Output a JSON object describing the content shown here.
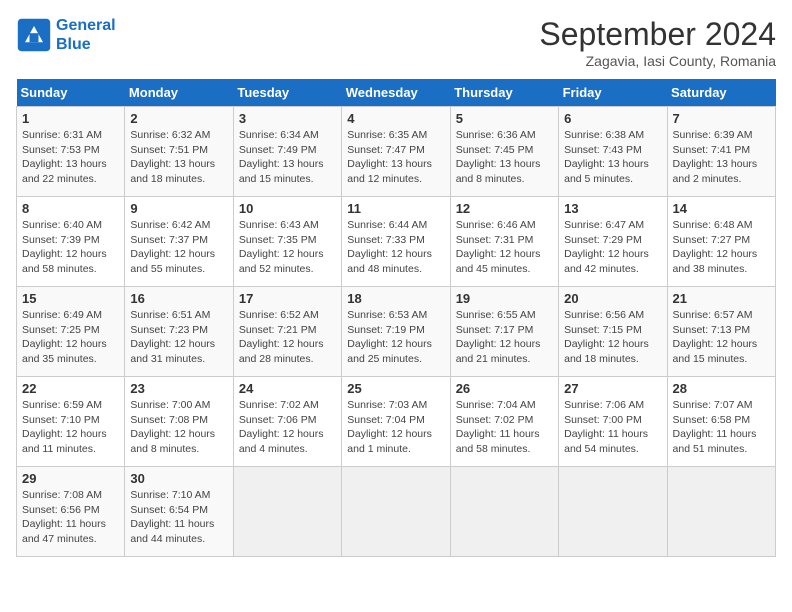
{
  "header": {
    "logo_line1": "General",
    "logo_line2": "Blue",
    "month": "September 2024",
    "location": "Zagavia, Iasi County, Romania"
  },
  "weekdays": [
    "Sunday",
    "Monday",
    "Tuesday",
    "Wednesday",
    "Thursday",
    "Friday",
    "Saturday"
  ],
  "weeks": [
    [
      {
        "day": "1",
        "sunrise": "Sunrise: 6:31 AM",
        "sunset": "Sunset: 7:53 PM",
        "daylight": "Daylight: 13 hours and 22 minutes."
      },
      {
        "day": "2",
        "sunrise": "Sunrise: 6:32 AM",
        "sunset": "Sunset: 7:51 PM",
        "daylight": "Daylight: 13 hours and 18 minutes."
      },
      {
        "day": "3",
        "sunrise": "Sunrise: 6:34 AM",
        "sunset": "Sunset: 7:49 PM",
        "daylight": "Daylight: 13 hours and 15 minutes."
      },
      {
        "day": "4",
        "sunrise": "Sunrise: 6:35 AM",
        "sunset": "Sunset: 7:47 PM",
        "daylight": "Daylight: 13 hours and 12 minutes."
      },
      {
        "day": "5",
        "sunrise": "Sunrise: 6:36 AM",
        "sunset": "Sunset: 7:45 PM",
        "daylight": "Daylight: 13 hours and 8 minutes."
      },
      {
        "day": "6",
        "sunrise": "Sunrise: 6:38 AM",
        "sunset": "Sunset: 7:43 PM",
        "daylight": "Daylight: 13 hours and 5 minutes."
      },
      {
        "day": "7",
        "sunrise": "Sunrise: 6:39 AM",
        "sunset": "Sunset: 7:41 PM",
        "daylight": "Daylight: 13 hours and 2 minutes."
      }
    ],
    [
      {
        "day": "8",
        "sunrise": "Sunrise: 6:40 AM",
        "sunset": "Sunset: 7:39 PM",
        "daylight": "Daylight: 12 hours and 58 minutes."
      },
      {
        "day": "9",
        "sunrise": "Sunrise: 6:42 AM",
        "sunset": "Sunset: 7:37 PM",
        "daylight": "Daylight: 12 hours and 55 minutes."
      },
      {
        "day": "10",
        "sunrise": "Sunrise: 6:43 AM",
        "sunset": "Sunset: 7:35 PM",
        "daylight": "Daylight: 12 hours and 52 minutes."
      },
      {
        "day": "11",
        "sunrise": "Sunrise: 6:44 AM",
        "sunset": "Sunset: 7:33 PM",
        "daylight": "Daylight: 12 hours and 48 minutes."
      },
      {
        "day": "12",
        "sunrise": "Sunrise: 6:46 AM",
        "sunset": "Sunset: 7:31 PM",
        "daylight": "Daylight: 12 hours and 45 minutes."
      },
      {
        "day": "13",
        "sunrise": "Sunrise: 6:47 AM",
        "sunset": "Sunset: 7:29 PM",
        "daylight": "Daylight: 12 hours and 42 minutes."
      },
      {
        "day": "14",
        "sunrise": "Sunrise: 6:48 AM",
        "sunset": "Sunset: 7:27 PM",
        "daylight": "Daylight: 12 hours and 38 minutes."
      }
    ],
    [
      {
        "day": "15",
        "sunrise": "Sunrise: 6:49 AM",
        "sunset": "Sunset: 7:25 PM",
        "daylight": "Daylight: 12 hours and 35 minutes."
      },
      {
        "day": "16",
        "sunrise": "Sunrise: 6:51 AM",
        "sunset": "Sunset: 7:23 PM",
        "daylight": "Daylight: 12 hours and 31 minutes."
      },
      {
        "day": "17",
        "sunrise": "Sunrise: 6:52 AM",
        "sunset": "Sunset: 7:21 PM",
        "daylight": "Daylight: 12 hours and 28 minutes."
      },
      {
        "day": "18",
        "sunrise": "Sunrise: 6:53 AM",
        "sunset": "Sunset: 7:19 PM",
        "daylight": "Daylight: 12 hours and 25 minutes."
      },
      {
        "day": "19",
        "sunrise": "Sunrise: 6:55 AM",
        "sunset": "Sunset: 7:17 PM",
        "daylight": "Daylight: 12 hours and 21 minutes."
      },
      {
        "day": "20",
        "sunrise": "Sunrise: 6:56 AM",
        "sunset": "Sunset: 7:15 PM",
        "daylight": "Daylight: 12 hours and 18 minutes."
      },
      {
        "day": "21",
        "sunrise": "Sunrise: 6:57 AM",
        "sunset": "Sunset: 7:13 PM",
        "daylight": "Daylight: 12 hours and 15 minutes."
      }
    ],
    [
      {
        "day": "22",
        "sunrise": "Sunrise: 6:59 AM",
        "sunset": "Sunset: 7:10 PM",
        "daylight": "Daylight: 12 hours and 11 minutes."
      },
      {
        "day": "23",
        "sunrise": "Sunrise: 7:00 AM",
        "sunset": "Sunset: 7:08 PM",
        "daylight": "Daylight: 12 hours and 8 minutes."
      },
      {
        "day": "24",
        "sunrise": "Sunrise: 7:02 AM",
        "sunset": "Sunset: 7:06 PM",
        "daylight": "Daylight: 12 hours and 4 minutes."
      },
      {
        "day": "25",
        "sunrise": "Sunrise: 7:03 AM",
        "sunset": "Sunset: 7:04 PM",
        "daylight": "Daylight: 12 hours and 1 minute."
      },
      {
        "day": "26",
        "sunrise": "Sunrise: 7:04 AM",
        "sunset": "Sunset: 7:02 PM",
        "daylight": "Daylight: 11 hours and 58 minutes."
      },
      {
        "day": "27",
        "sunrise": "Sunrise: 7:06 AM",
        "sunset": "Sunset: 7:00 PM",
        "daylight": "Daylight: 11 hours and 54 minutes."
      },
      {
        "day": "28",
        "sunrise": "Sunrise: 7:07 AM",
        "sunset": "Sunset: 6:58 PM",
        "daylight": "Daylight: 11 hours and 51 minutes."
      }
    ],
    [
      {
        "day": "29",
        "sunrise": "Sunrise: 7:08 AM",
        "sunset": "Sunset: 6:56 PM",
        "daylight": "Daylight: 11 hours and 47 minutes."
      },
      {
        "day": "30",
        "sunrise": "Sunrise: 7:10 AM",
        "sunset": "Sunset: 6:54 PM",
        "daylight": "Daylight: 11 hours and 44 minutes."
      },
      {
        "day": "",
        "sunrise": "",
        "sunset": "",
        "daylight": ""
      },
      {
        "day": "",
        "sunrise": "",
        "sunset": "",
        "daylight": ""
      },
      {
        "day": "",
        "sunrise": "",
        "sunset": "",
        "daylight": ""
      },
      {
        "day": "",
        "sunrise": "",
        "sunset": "",
        "daylight": ""
      },
      {
        "day": "",
        "sunrise": "",
        "sunset": "",
        "daylight": ""
      }
    ]
  ]
}
